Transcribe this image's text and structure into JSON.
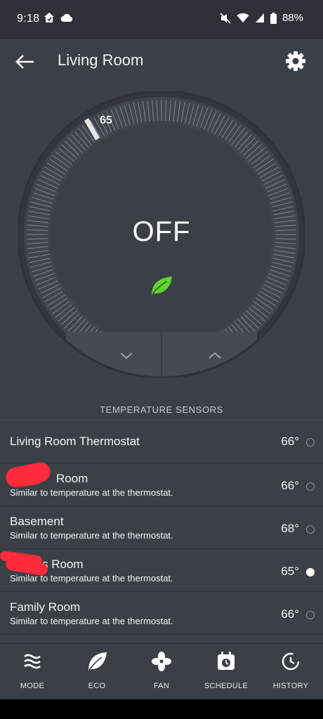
{
  "status_bar": {
    "time": "9:18",
    "battery_text": "88%",
    "left_icons": [
      "home-icon",
      "cloud-icon"
    ],
    "right_icons": [
      "mute-icon",
      "wifi-icon",
      "signal-icon",
      "battery-icon"
    ]
  },
  "app_bar": {
    "title": "Living Room",
    "back_icon": "arrow-left-icon",
    "settings_icon": "gear-icon"
  },
  "thermostat": {
    "mode_text": "OFF",
    "setpoint": "65",
    "eco_icon": "leaf-icon",
    "eco_color": "#5fd62a",
    "down_icon": "chevron-down-icon",
    "up_icon": "chevron-up-icon"
  },
  "sensors": {
    "header": "TEMPERATURE SENSORS",
    "items": [
      {
        "name": "Living Room Thermostat",
        "note": "",
        "temp": "66°",
        "selected": false
      },
      {
        "name": "Room",
        "note": "Similar to temperature at the thermostat.",
        "temp": "66°",
        "selected": false
      },
      {
        "name": "Basement",
        "note": "Similar to temperature at the thermostat.",
        "temp": "68°",
        "selected": false
      },
      {
        "name": "s Room",
        "note": "Similar to temperature at the thermostat.",
        "temp": "65°",
        "selected": true
      },
      {
        "name": "Family Room",
        "note": "Similar to temperature at the thermostat.",
        "temp": "66°",
        "selected": false
      }
    ]
  },
  "bottom_nav": {
    "items": [
      {
        "label": "MODE",
        "icon": "mode-icon"
      },
      {
        "label": "ECO",
        "icon": "leaf-icon"
      },
      {
        "label": "FAN",
        "icon": "fan-icon"
      },
      {
        "label": "SCHEDULE",
        "icon": "calendar-icon"
      },
      {
        "label": "HISTORY",
        "icon": "history-icon"
      }
    ]
  }
}
